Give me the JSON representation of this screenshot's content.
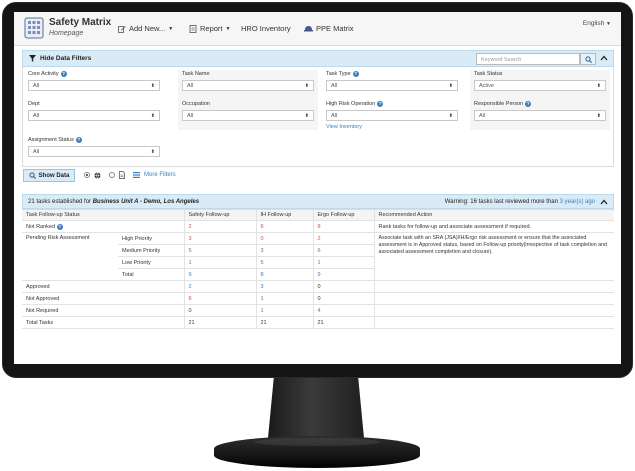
{
  "app": {
    "title": "Safety Matrix",
    "subtitle": "Homepage",
    "language": "English"
  },
  "nav": {
    "add_new": "Add New...",
    "report": "Report",
    "hro_inventory": "HRO Inventory",
    "ppe_matrix": "PPE Matrix"
  },
  "filters": {
    "header": "Hide Data Filters",
    "keyword_placeholder": "Keyword Search",
    "core_activity": {
      "label": "Core Activity",
      "value": "All"
    },
    "task_name": {
      "label": "Task Name",
      "value": "All"
    },
    "task_type": {
      "label": "Task Type",
      "value": "All"
    },
    "task_status": {
      "label": "Task Status",
      "value": "Active"
    },
    "dept": {
      "label": "Dept",
      "value": "All"
    },
    "occupation": {
      "label": "Occupation",
      "value": "All"
    },
    "high_risk_operation": {
      "label": "High Risk Operation",
      "value": "All"
    },
    "view_inventory": "View Inventory",
    "responsible_person": {
      "label": "Responsible Person",
      "value": "All"
    },
    "assignment_status": {
      "label": "Assignment Status",
      "value": "All"
    },
    "show_data": "Show Data",
    "more_filters": "More Filters"
  },
  "results": {
    "summary_prefix": "21 tasks established for",
    "summary_unit": "Business Unit A - Demo, Los Angeles",
    "warning_prefix": "Warning: 16 tasks last reviewed more than",
    "warning_link": "3 year(s) ago",
    "headers": {
      "status": "Task Follow-up Status",
      "safety": "Safety Follow-up",
      "ih": "IH Follow-up",
      "ergo": "Ergo Follow-up",
      "action": "Recommended Action"
    },
    "rows": {
      "not_ranked": {
        "label": "Not Ranked",
        "safety": "2",
        "ih": "8",
        "ergo": "8",
        "action": "Rank tasks for follow-up and associate assessment if required."
      },
      "pending": {
        "label": "Pending Risk Assessment",
        "action": "Associate task with an SRA (JSA)/IH/Ergo risk assessment or ensure that the associated assessment is in Approved status, based on Follow-up priority(irrespective of task completion and associated assessment completion and closure).",
        "high": {
          "label": "High Priority",
          "safety": "3",
          "ih": "0",
          "ergo": "2"
        },
        "medium": {
          "label": "Medium Priority",
          "safety": "5",
          "ih": "3",
          "ergo": "6"
        },
        "low": {
          "label": "Low Priority",
          "safety": "1",
          "ih": "5",
          "ergo": "1"
        },
        "total": {
          "label": "Total",
          "safety": "9",
          "ih": "8",
          "ergo": "9"
        }
      },
      "approved": {
        "label": "Approved",
        "safety": "2",
        "ih": "3",
        "ergo": "0"
      },
      "not_approved": {
        "label": "Not Approved",
        "safety": "8",
        "ih": "1",
        "ergo": "0"
      },
      "not_required": {
        "label": "Not Required",
        "safety": "0",
        "ih": "1",
        "ergo": "4"
      },
      "total_tasks": {
        "label": "Total Tasks",
        "safety": "21",
        "ih": "21",
        "ergo": "21"
      }
    }
  },
  "colors": {
    "accent": "#3a7fc1",
    "panel_header": "#d9ebf7",
    "alert": "#d9534f"
  }
}
